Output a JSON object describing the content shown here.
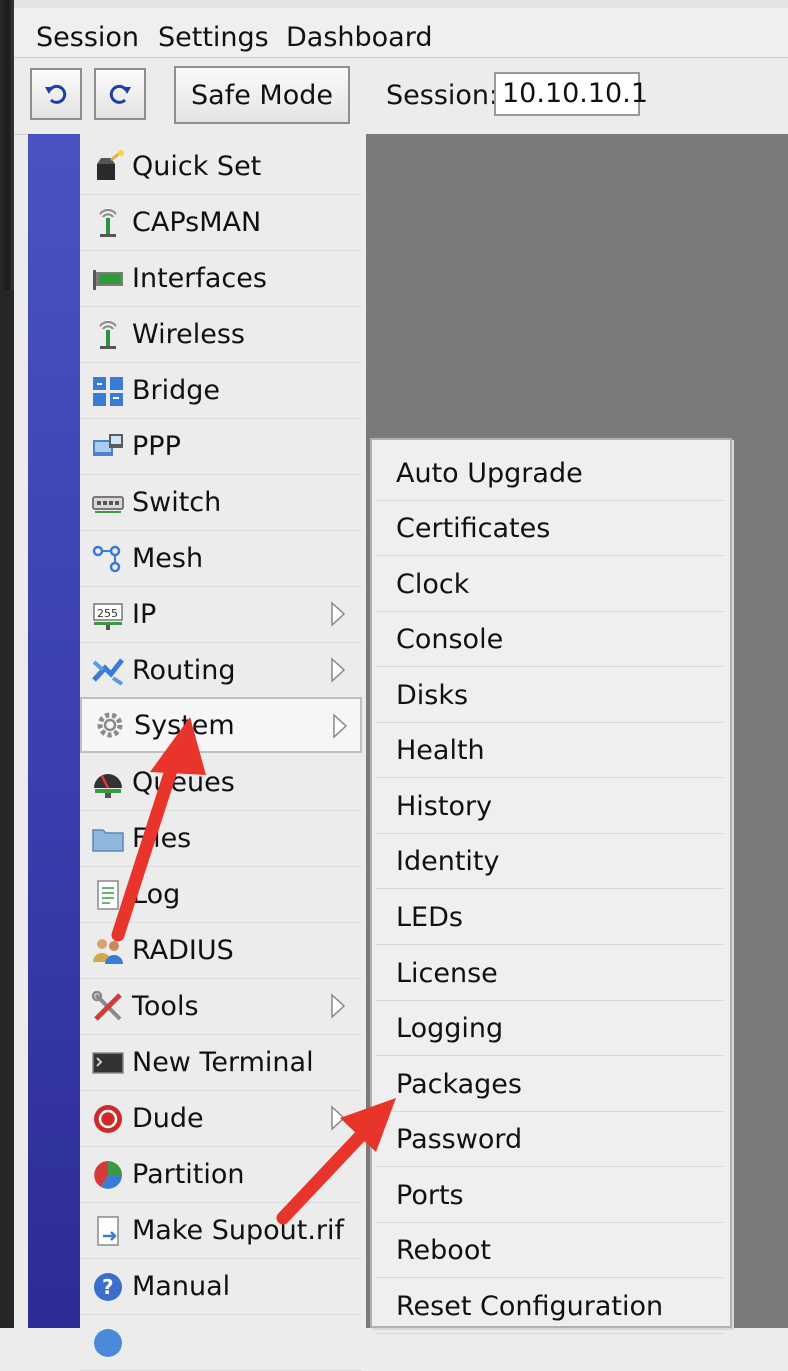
{
  "menubar": {
    "items": [
      "Session",
      "Settings",
      "Dashboard"
    ]
  },
  "toolbar": {
    "undo_icon": "undo-icon",
    "redo_icon": "redo-icon",
    "safe_mode_label": "Safe Mode",
    "session_label": "Session:",
    "session_value": "10.10.10.1"
  },
  "sidebar": {
    "items": [
      {
        "label": "Quick Set",
        "icon": "wand-icon",
        "submenu": false
      },
      {
        "label": "CAPsMAN",
        "icon": "antenna-icon",
        "submenu": false
      },
      {
        "label": "Interfaces",
        "icon": "network-card-icon",
        "submenu": false
      },
      {
        "label": "Wireless",
        "icon": "antenna-icon",
        "submenu": false
      },
      {
        "label": "Bridge",
        "icon": "bridge-icon",
        "submenu": false
      },
      {
        "label": "PPP",
        "icon": "ppp-icon",
        "submenu": false
      },
      {
        "label": "Switch",
        "icon": "switch-icon",
        "submenu": false
      },
      {
        "label": "Mesh",
        "icon": "mesh-icon",
        "submenu": false
      },
      {
        "label": "IP",
        "icon": "ip-icon",
        "submenu": true
      },
      {
        "label": "Routing",
        "icon": "routing-icon",
        "submenu": true
      },
      {
        "label": "System",
        "icon": "gear-icon",
        "submenu": true,
        "active": true
      },
      {
        "label": "Queues",
        "icon": "gauge-icon",
        "submenu": false
      },
      {
        "label": "Files",
        "icon": "folder-icon",
        "submenu": false
      },
      {
        "label": "Log",
        "icon": "document-icon",
        "submenu": false
      },
      {
        "label": "RADIUS",
        "icon": "users-icon",
        "submenu": false
      },
      {
        "label": "Tools",
        "icon": "tools-icon",
        "submenu": true
      },
      {
        "label": "New Terminal",
        "icon": "terminal-icon",
        "submenu": false
      },
      {
        "label": "Dude",
        "icon": "dude-icon",
        "submenu": true
      },
      {
        "label": "Partition",
        "icon": "pie-icon",
        "submenu": false
      },
      {
        "label": "Make Supout.rif",
        "icon": "file-export-icon",
        "submenu": false
      },
      {
        "label": "Manual",
        "icon": "help-icon",
        "submenu": false
      }
    ]
  },
  "submenu": {
    "items": [
      "Auto Upgrade",
      "Certificates",
      "Clock",
      "Console",
      "Disks",
      "Health",
      "History",
      "Identity",
      "LEDs",
      "License",
      "Logging",
      "Packages",
      "Password",
      "Ports",
      "Reboot",
      "Reset Configuration"
    ]
  },
  "colors": {
    "accent_strip": "#3b3fb0",
    "annotation_arrow": "#e8342a",
    "workspace": "#7a7a7a"
  }
}
